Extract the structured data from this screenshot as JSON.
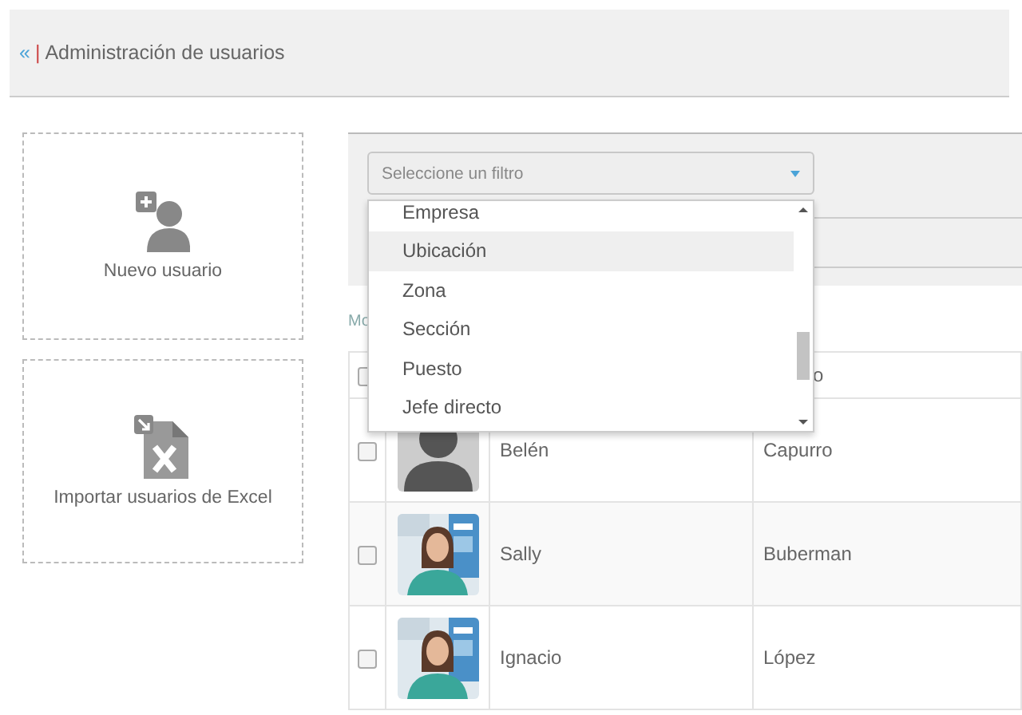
{
  "header": {
    "back": "«",
    "separator": "|",
    "title": "Administración de usuarios"
  },
  "actions": [
    {
      "kind": "new-user",
      "label": "Nuevo usuario"
    },
    {
      "kind": "import-excel",
      "label": "Importar usuarios de Excel"
    }
  ],
  "filter": {
    "placeholder": "Seleccione un filtro",
    "options": [
      {
        "label": "Empresa",
        "highlighted": false
      },
      {
        "label": "Ubicación",
        "highlighted": true
      },
      {
        "label": "Zona",
        "highlighted": false
      },
      {
        "label": "Sección",
        "highlighted": false
      },
      {
        "label": "Puesto",
        "highlighted": false
      },
      {
        "label": "Jefe directo",
        "highlighted": false
      }
    ]
  },
  "partial_text": "Mo",
  "table": {
    "header": {
      "checked": false,
      "column_4": "o"
    },
    "rows": [
      {
        "checked": false,
        "kind": "silhouette",
        "first_name": "Belén",
        "last_name": "Capurro"
      },
      {
        "checked": false,
        "kind": "picture",
        "first_name": "Sally",
        "last_name": "Buberman"
      },
      {
        "checked": false,
        "kind": "picture",
        "first_name": "Ignacio",
        "last_name": "López"
      }
    ]
  }
}
